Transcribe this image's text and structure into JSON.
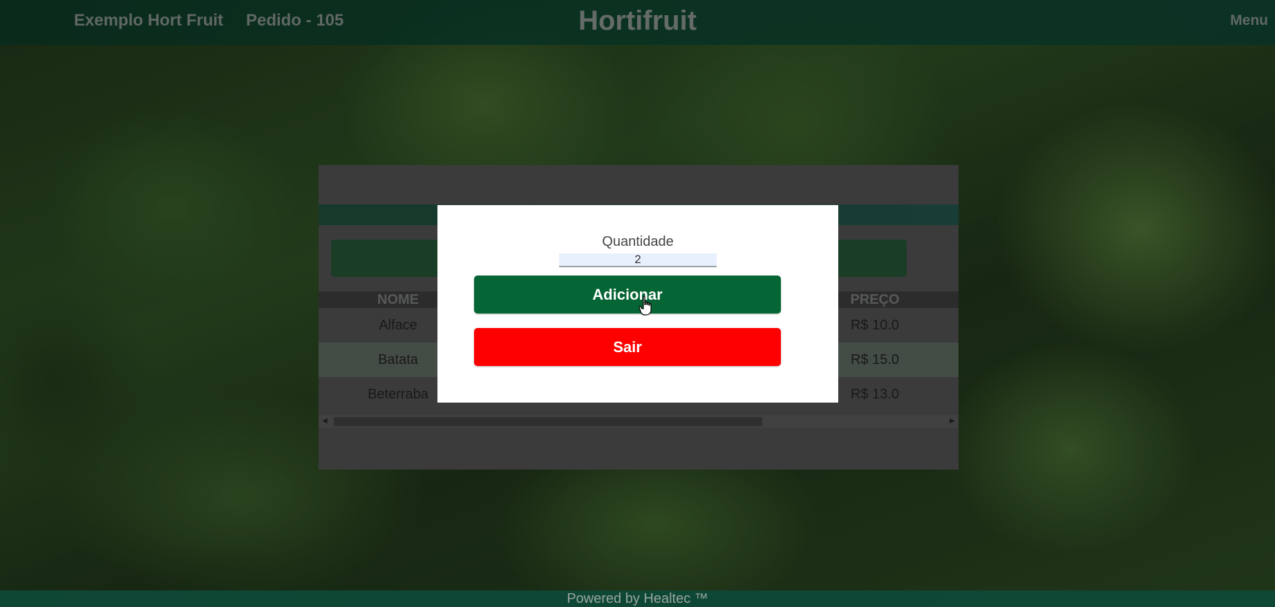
{
  "header": {
    "app_name": "Exemplo Hort Fruit",
    "order_label": "Pedido - 105",
    "brand": "Hortifruit",
    "menu_label": "Menu"
  },
  "table": {
    "columns": [
      "NOME",
      "PREÇO"
    ],
    "rows": [
      {
        "name": "Alface",
        "price": "R$ 10.0"
      },
      {
        "name": "Batata",
        "price": "R$ 15.0"
      },
      {
        "name": "Beterraba",
        "price": "R$ 13.0"
      }
    ]
  },
  "modal": {
    "quantity_label": "Quantidade",
    "quantity_value": "2",
    "add_button": "Adicionar",
    "exit_button": "Sair"
  },
  "footer": {
    "text": "Powered by Healtec ™"
  },
  "colors": {
    "header_bg": "#0e5a40",
    "add_button": "#056534",
    "exit_button": "#ff0000"
  },
  "icons": [
    "hand-cursor-icon",
    "scroll-left-icon",
    "scroll-right-icon"
  ]
}
